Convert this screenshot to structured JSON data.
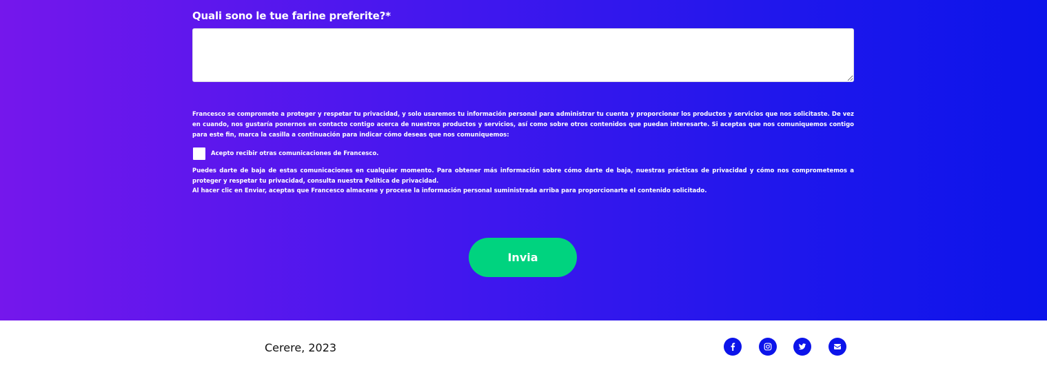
{
  "form": {
    "question_label": "Quali sono le tue farine preferite?*",
    "answer_value": "",
    "privacy_text": "Francesco se compromete a proteger y respetar tu privacidad, y solo usaremos tu información personal para administrar tu cuenta y proporcionar los productos y servicios que nos solicitaste. De vez en cuando, nos gustaría ponernos en contacto contigo acerca de nuestros productos y servicios, así como sobre otros contenidos que puedan interesarte. Si aceptas que nos comuniquemos contigo para este fin, marca la casilla a continuación para indicar cómo deseas que nos comuniquemos:",
    "checkbox_label": "Acepto recibir otras comunicaciones de Francesco.",
    "unsubscribe_text": "Puedes darte de baja de estas comunicaciones en cualquier momento. Para obtener más información sobre cómo darte de baja, nuestras prácticas de privacidad y cómo nos comprometemos a proteger y respetar tu privacidad, consulta nuestra Política de privacidad.",
    "consent_text": "Al hacer clic en Enviar, aceptas que Francesco almacene y procese la información personal suministrada arriba para proporcionarte el contenido solicitado.",
    "submit_label": "Invia"
  },
  "footer": {
    "copyright": "Cerere, 2023",
    "social_icons": [
      "facebook-icon",
      "instagram-icon",
      "twitter-icon",
      "email-icon"
    ]
  },
  "colors": {
    "gradient_start": "#7517ec",
    "gradient_end": "#0c14ea",
    "submit_button": "#00d37f",
    "social_icon_bg": "#0c14ea"
  }
}
